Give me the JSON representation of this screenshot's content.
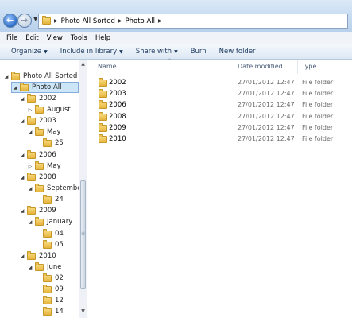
{
  "address": {
    "crumbs": [
      "Photo All Sorted",
      "Photo All"
    ]
  },
  "menu": [
    "File",
    "Edit",
    "View",
    "Tools",
    "Help"
  ],
  "command_bar": {
    "organize": "Organize",
    "include_in_library": "Include in library",
    "share_with": "Share with",
    "burn": "Burn",
    "new_folder": "New folder"
  },
  "tree": [
    {
      "label": "Photo All Sorted",
      "expander": "open"
    },
    {
      "label": "Photo All",
      "expander": "open",
      "selected": true
    },
    {
      "label": "2002",
      "expander": "open"
    },
    {
      "label": "August",
      "expander": "closed"
    },
    {
      "label": "2003",
      "expander": "open"
    },
    {
      "label": "May",
      "expander": "open"
    },
    {
      "label": "25",
      "expander": "none"
    },
    {
      "label": "2006",
      "expander": "open"
    },
    {
      "label": "May",
      "expander": "closed"
    },
    {
      "label": "2008",
      "expander": "open"
    },
    {
      "label": "September",
      "expander": "open"
    },
    {
      "label": "24",
      "expander": "none"
    },
    {
      "label": "2009",
      "expander": "open"
    },
    {
      "label": "January",
      "expander": "open"
    },
    {
      "label": "04",
      "expander": "none"
    },
    {
      "label": "05",
      "expander": "none"
    },
    {
      "label": "2010",
      "expander": "open"
    },
    {
      "label": "June",
      "expander": "open"
    },
    {
      "label": "02",
      "expander": "none"
    },
    {
      "label": "09",
      "expander": "none"
    },
    {
      "label": "12",
      "expander": "none"
    },
    {
      "label": "14",
      "expander": "none"
    }
  ],
  "columns": {
    "name": "Name",
    "date_modified": "Date modified",
    "type": "Type"
  },
  "files": [
    {
      "name": "2002",
      "date": "27/01/2012 12:47",
      "type": "File folder"
    },
    {
      "name": "2003",
      "date": "27/01/2012 12:47",
      "type": "File folder"
    },
    {
      "name": "2006",
      "date": "27/01/2012 12:47",
      "type": "File folder"
    },
    {
      "name": "2008",
      "date": "27/01/2012 12:47",
      "type": "File folder"
    },
    {
      "name": "2009",
      "date": "27/01/2012 12:47",
      "type": "File folder"
    },
    {
      "name": "2010",
      "date": "27/01/2012 12:47",
      "type": "File folder"
    }
  ],
  "colors": {
    "selection": "#cde6f7",
    "selection_border": "#84acdd",
    "folder": "#e5b53c"
  }
}
